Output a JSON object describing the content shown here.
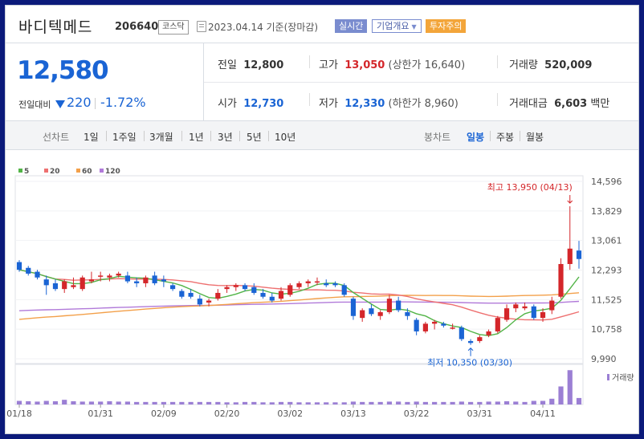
{
  "stock": {
    "name": "바디텍메드",
    "code": "206640",
    "market": "코스닥",
    "date": "2023.04.14 기준(장마감)",
    "buttons": {
      "realtime": "실시간",
      "company": "기업개요",
      "warning": "투자주의"
    },
    "chevron_icon": "chevron-down-icon",
    "calendar_icon": "calendar-icon"
  },
  "price": {
    "current": "12,580",
    "change_label": "전일대비",
    "change": "220",
    "change_pct": "-1.72%",
    "direction_icon": "down-triangle-icon"
  },
  "stats": {
    "prev_label": "전일",
    "prev": "12,800",
    "open_label": "시가",
    "open": "12,730",
    "high_label": "고가",
    "high": "13,050",
    "upper_limit": "(상한가 16,640)",
    "low_label": "저가",
    "low": "12,330",
    "lower_limit": "(하한가 8,960)",
    "volume_label": "거래량",
    "volume": "520,009",
    "amount_label": "거래대금",
    "amount": "6,603",
    "amount_unit": "백만"
  },
  "periods": {
    "line_label": "선차트",
    "line": [
      "1일",
      "1주일",
      "3개월",
      "1년",
      "3년",
      "5년",
      "10년"
    ],
    "candle_label": "봉차트",
    "candle": [
      "일봉",
      "주봉",
      "월봉"
    ],
    "active": "일봉"
  },
  "colors": {
    "up": "#d4262a",
    "down": "#1a64d4",
    "ma5": "#52b447",
    "ma20": "#ee7070",
    "ma60": "#f3a04a",
    "ma120": "#b17ad9"
  },
  "chart_data": {
    "type": "candlestick",
    "legend": [
      {
        "name": "5",
        "color": "#52b447"
      },
      {
        "name": "20",
        "color": "#ee7070"
      },
      {
        "name": "60",
        "color": "#f3a04a"
      },
      {
        "name": "120",
        "color": "#b17ad9"
      }
    ],
    "y_ticks": [
      "14,596",
      "13,829",
      "13,061",
      "12,293",
      "11,525",
      "10,758",
      "9,990"
    ],
    "ylim": [
      9990,
      14596
    ],
    "x_ticks": [
      "01/18",
      "01/31",
      "02/09",
      "02/20",
      "03/02",
      "03/13",
      "03/22",
      "03/31",
      "04/11"
    ],
    "x_tick_index": [
      0,
      9,
      16,
      23,
      30,
      37,
      44,
      51,
      58
    ],
    "volume_label": "거래량",
    "annotations": {
      "high": "최고 13,950 (04/13)",
      "low": "최저 10,350 (03/30)"
    },
    "candles": [
      [
        12500,
        12550,
        12250,
        12300
      ],
      [
        12350,
        12400,
        12150,
        12200
      ],
      [
        12250,
        12300,
        12050,
        12100
      ],
      [
        12050,
        12150,
        11650,
        11900
      ],
      [
        11950,
        12050,
        11750,
        11800
      ],
      [
        11800,
        12050,
        11700,
        12000
      ],
      [
        11850,
        12100,
        11800,
        11900
      ],
      [
        11800,
        12150,
        11750,
        12100
      ],
      [
        12000,
        12250,
        11950,
        12050
      ],
      [
        12150,
        12250,
        12000,
        12150
      ],
      [
        12100,
        12200,
        12000,
        12150
      ],
      [
        12150,
        12250,
        12100,
        12200
      ],
      [
        12150,
        12250,
        11950,
        12000
      ],
      [
        12000,
        12100,
        11850,
        11950
      ],
      [
        11950,
        12150,
        11850,
        12100
      ],
      [
        12150,
        12250,
        11900,
        11950
      ],
      [
        12050,
        12150,
        11850,
        12000
      ],
      [
        11900,
        11950,
        11750,
        11800
      ],
      [
        11750,
        11800,
        11550,
        11600
      ],
      [
        11700,
        11800,
        11550,
        11600
      ],
      [
        11550,
        11650,
        11350,
        11400
      ],
      [
        11450,
        11550,
        11350,
        11500
      ],
      [
        11550,
        11800,
        11500,
        11700
      ],
      [
        11800,
        11900,
        11700,
        11850
      ],
      [
        11850,
        11950,
        11750,
        11900
      ],
      [
        11900,
        11950,
        11750,
        11800
      ],
      [
        11850,
        11950,
        11650,
        11700
      ],
      [
        11700,
        11800,
        11550,
        11600
      ],
      [
        11600,
        11700,
        11450,
        11500
      ],
      [
        11550,
        11850,
        11500,
        11750
      ],
      [
        11650,
        11950,
        11600,
        11900
      ],
      [
        11850,
        12000,
        11800,
        11950
      ],
      [
        11950,
        12050,
        11850,
        12000
      ],
      [
        12000,
        12100,
        11900,
        12000
      ],
      [
        11950,
        12050,
        11850,
        11900
      ],
      [
        11950,
        12000,
        11850,
        11900
      ],
      [
        11900,
        11950,
        11600,
        11650
      ],
      [
        11550,
        11600,
        11000,
        11100
      ],
      [
        11050,
        11300,
        10950,
        11250
      ],
      [
        11300,
        11400,
        11100,
        11150
      ],
      [
        11100,
        11250,
        11000,
        11200
      ],
      [
        11200,
        11650,
        11150,
        11550
      ],
      [
        11500,
        11600,
        11200,
        11250
      ],
      [
        11200,
        11300,
        11000,
        11100
      ],
      [
        11000,
        11050,
        10600,
        10700
      ],
      [
        10700,
        10950,
        10650,
        10900
      ],
      [
        10900,
        11000,
        10750,
        10950
      ],
      [
        10900,
        10950,
        10800,
        10850
      ],
      [
        10800,
        10900,
        10750,
        10800
      ],
      [
        10800,
        10850,
        10450,
        10500
      ],
      [
        10450,
        10500,
        10350,
        10400
      ],
      [
        10450,
        10600,
        10400,
        10550
      ],
      [
        10600,
        10750,
        10550,
        10700
      ],
      [
        10700,
        11100,
        10650,
        11050
      ],
      [
        11000,
        11400,
        10950,
        11300
      ],
      [
        11300,
        11450,
        11200,
        11400
      ],
      [
        11300,
        11450,
        11250,
        11350
      ],
      [
        11350,
        11400,
        11000,
        11050
      ],
      [
        11050,
        11300,
        10950,
        11200
      ],
      [
        11250,
        11600,
        11150,
        11500
      ],
      [
        11600,
        12600,
        11550,
        12450
      ],
      [
        12450,
        13950,
        12300,
        12850
      ],
      [
        12800,
        13050,
        12330,
        12580
      ]
    ],
    "volumes": [
      0.1,
      0.09,
      0.08,
      0.1,
      0.09,
      0.13,
      0.09,
      0.08,
      0.08,
      0.08,
      0.09,
      0.08,
      0.08,
      0.07,
      0.07,
      0.07,
      0.07,
      0.07,
      0.07,
      0.07,
      0.07,
      0.07,
      0.07,
      0.06,
      0.06,
      0.07,
      0.07,
      0.06,
      0.06,
      0.07,
      0.07,
      0.06,
      0.06,
      0.06,
      0.06,
      0.06,
      0.06,
      0.08,
      0.07,
      0.07,
      0.07,
      0.08,
      0.08,
      0.07,
      0.08,
      0.07,
      0.07,
      0.07,
      0.07,
      0.08,
      0.07,
      0.07,
      0.08,
      0.08,
      0.09,
      0.08,
      0.07,
      0.1,
      0.1,
      0.16,
      0.5,
      0.95,
      0.18
    ]
  }
}
